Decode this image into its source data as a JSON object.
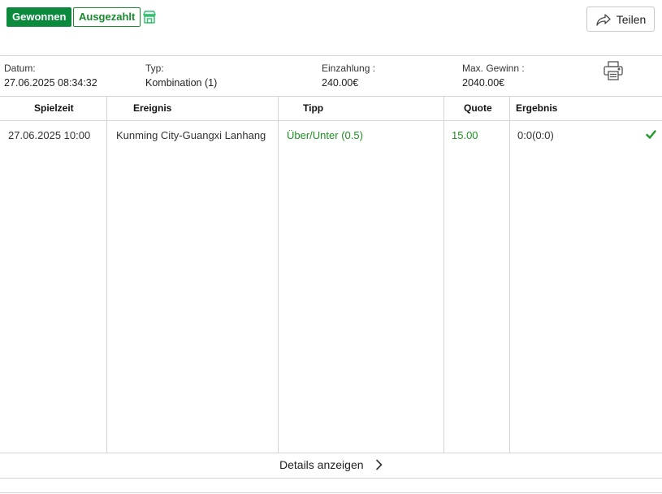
{
  "header": {
    "status_won": "Gewonnen",
    "status_paid": "Ausgezahlt",
    "share_label": "Teilen"
  },
  "info": {
    "date_label": "Datum:",
    "date_value": "27.06.2025 08:34:32",
    "type_label": "Typ:",
    "type_value": "Kombination (1)",
    "stake_label": "Einzahlung :",
    "stake_value": "240.00€",
    "max_win_label": "Max. Gewinn :",
    "max_win_value": "2040.00€"
  },
  "table": {
    "columns": [
      "Spielzeit",
      "Ereignis",
      "Tipp",
      "Quote",
      "Ergebnis"
    ],
    "rows": [
      {
        "time": "27.06.2025 10:00",
        "event": "Kunming City-Guangxi Lanhang",
        "tip": "Über/Unter (0.5)",
        "odds": "15.00",
        "result": "0:0(0:0)"
      }
    ]
  },
  "footer": {
    "details_label": "Details anzeigen"
  },
  "colors": {
    "accent_green": "#0b8a3e",
    "text_green": "#1e8f22"
  },
  "icons": [
    "store-icon",
    "share-arrow-icon",
    "printer-icon",
    "checkmark-icon",
    "chevron-right-icon"
  ]
}
